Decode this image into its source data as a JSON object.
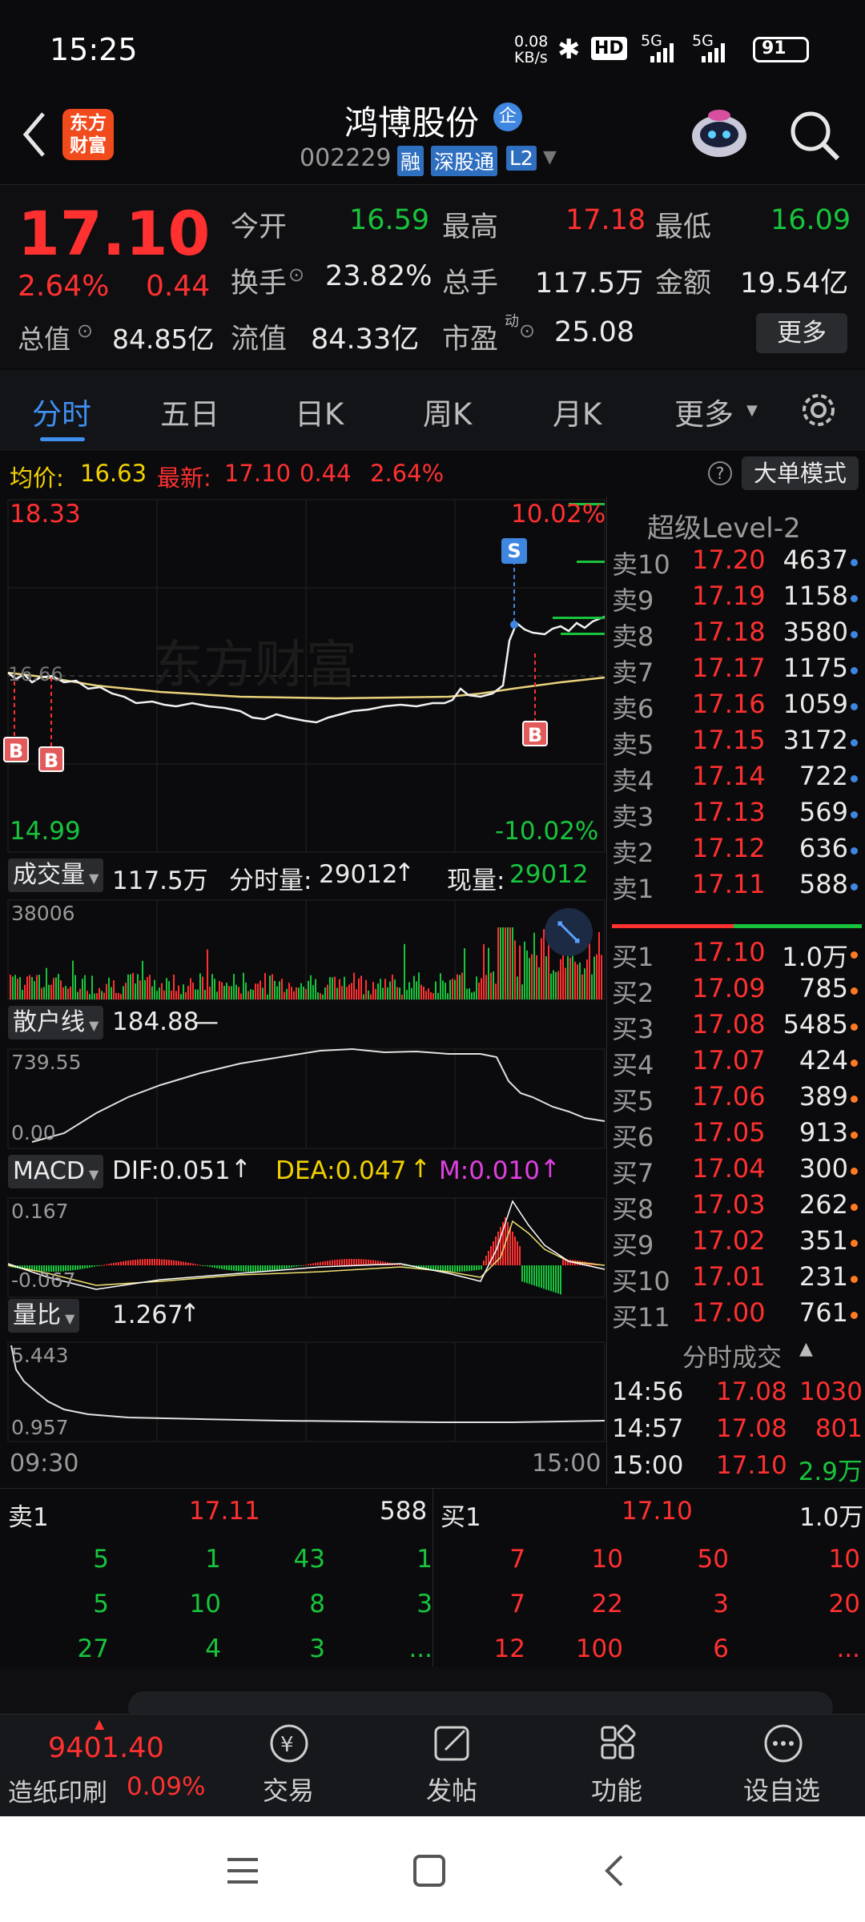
{
  "status": {
    "time": "15:25",
    "speed": "0.08\nKB/s",
    "speed_top": "0.08",
    "speed_bottom": "KB/s",
    "hd": "HD",
    "net1": "5G",
    "net2": "5G",
    "battery": "91"
  },
  "header": {
    "logo_top": "东方",
    "logo_bottom": "财富",
    "name": "鸿博股份",
    "badge": "企",
    "code": "002229",
    "tags": [
      "融",
      "深股通",
      "L2"
    ]
  },
  "quote": {
    "price": "17.10",
    "pct": "2.64%",
    "change": "0.44",
    "fields": [
      {
        "label": "今开",
        "value": "16.59"
      },
      {
        "label": "最高",
        "value": "17.18"
      },
      {
        "label": "最低",
        "value": "16.09"
      },
      {
        "label": "换手",
        "value": "23.82%"
      },
      {
        "label": "总手",
        "value": "117.5万"
      },
      {
        "label": "金额",
        "value": "19.54亿"
      },
      {
        "label": "总值",
        "value": "84.85亿"
      },
      {
        "label": "流值",
        "value": "84.33亿"
      },
      {
        "label": "市盈",
        "value": "25.08"
      }
    ],
    "sup": "动",
    "more": "更多"
  },
  "tabs": [
    "分时",
    "五日",
    "日K",
    "周K",
    "月K",
    "更多"
  ],
  "avgbar": {
    "avg_label": "均价:",
    "avg": "16.63",
    "latest_label": "最新:",
    "latest": "17.10",
    "chg": "0.44",
    "pct": "2.64%",
    "mode": "大单模式",
    "help": "?"
  },
  "chart": {
    "high": "18.33",
    "low": "14.99",
    "high_pct": "10.02%",
    "low_pct": "-10.02%",
    "watermark": "东方财富",
    "ref_price": "16.66",
    "markers": {
      "s": "S",
      "b": "B"
    },
    "volume": {
      "label": "成交量",
      "total": "117.5万",
      "ftime_label": "分时量:",
      "ftime_val": "29012",
      "now_label": "现量:",
      "now_val": "29012",
      "max": "38006"
    },
    "retail": {
      "label": "散户线",
      "value": "184.88",
      "max": "739.55",
      "min": "0.00"
    },
    "macd": {
      "label": "MACD",
      "dif": "DIF:0.051",
      "dea": "DEA:0.047",
      "m": "M:0.010",
      "max": "0.167",
      "min": "-0.067"
    },
    "ratio": {
      "label": "量比",
      "value": "1.267",
      "max": "5.443",
      "min": "0.957"
    },
    "time_start": "09:30",
    "time_end": "15:00"
  },
  "orderbook": {
    "title": "超级Level-2",
    "asks": [
      {
        "l": "卖10",
        "p": "17.20",
        "v": "4637"
      },
      {
        "l": "卖9",
        "p": "17.19",
        "v": "1158"
      },
      {
        "l": "卖8",
        "p": "17.18",
        "v": "3580"
      },
      {
        "l": "卖7",
        "p": "17.17",
        "v": "1175"
      },
      {
        "l": "卖6",
        "p": "17.16",
        "v": "1059"
      },
      {
        "l": "卖5",
        "p": "17.15",
        "v": "3172"
      },
      {
        "l": "卖4",
        "p": "17.14",
        "v": "722"
      },
      {
        "l": "卖3",
        "p": "17.13",
        "v": "569"
      },
      {
        "l": "卖2",
        "p": "17.12",
        "v": "636"
      },
      {
        "l": "卖1",
        "p": "17.11",
        "v": "588"
      }
    ],
    "bids": [
      {
        "l": "买1",
        "p": "17.10",
        "v": "1.0万"
      },
      {
        "l": "买2",
        "p": "17.09",
        "v": "785"
      },
      {
        "l": "买3",
        "p": "17.08",
        "v": "5485"
      },
      {
        "l": "买4",
        "p": "17.07",
        "v": "424"
      },
      {
        "l": "买5",
        "p": "17.06",
        "v": "389"
      },
      {
        "l": "买6",
        "p": "17.05",
        "v": "913"
      },
      {
        "l": "买7",
        "p": "17.04",
        "v": "300"
      },
      {
        "l": "买8",
        "p": "17.03",
        "v": "262"
      },
      {
        "l": "买9",
        "p": "17.02",
        "v": "351"
      },
      {
        "l": "买10",
        "p": "17.01",
        "v": "231"
      },
      {
        "l": "买11",
        "p": "17.00",
        "v": "761"
      }
    ],
    "trades_title": "分时成交",
    "trades": [
      {
        "t": "14:56",
        "p": "17.08",
        "v": "1030"
      },
      {
        "t": "14:57",
        "p": "17.08",
        "v": "801"
      },
      {
        "t": "15:00",
        "p": "17.10",
        "v": "2.9万"
      }
    ]
  },
  "queue": {
    "sell_label": "卖1",
    "sell_price": "17.11",
    "sell_vol": "588",
    "buy_label": "买1",
    "buy_price": "17.10",
    "buy_vol": "1.0万",
    "sell_rows": [
      [
        "5",
        "1",
        "43",
        "1"
      ],
      [
        "5",
        "10",
        "8",
        "3"
      ],
      [
        "27",
        "4",
        "3",
        "..."
      ]
    ],
    "buy_rows": [
      [
        "7",
        "10",
        "50",
        "10"
      ],
      [
        "7",
        "22",
        "3",
        "20"
      ],
      [
        "12",
        "100",
        "6",
        "..."
      ]
    ]
  },
  "bottom": {
    "index_value": "9401.40",
    "index_name": "造纸印刷",
    "index_pct": "0.09%",
    "items": [
      "交易",
      "发帖",
      "功能",
      "设自选"
    ]
  },
  "colors": {
    "up": "#ff3030",
    "down": "#18c43c",
    "accent": "#2f7fd8",
    "avg_line": "#e8d27a"
  }
}
